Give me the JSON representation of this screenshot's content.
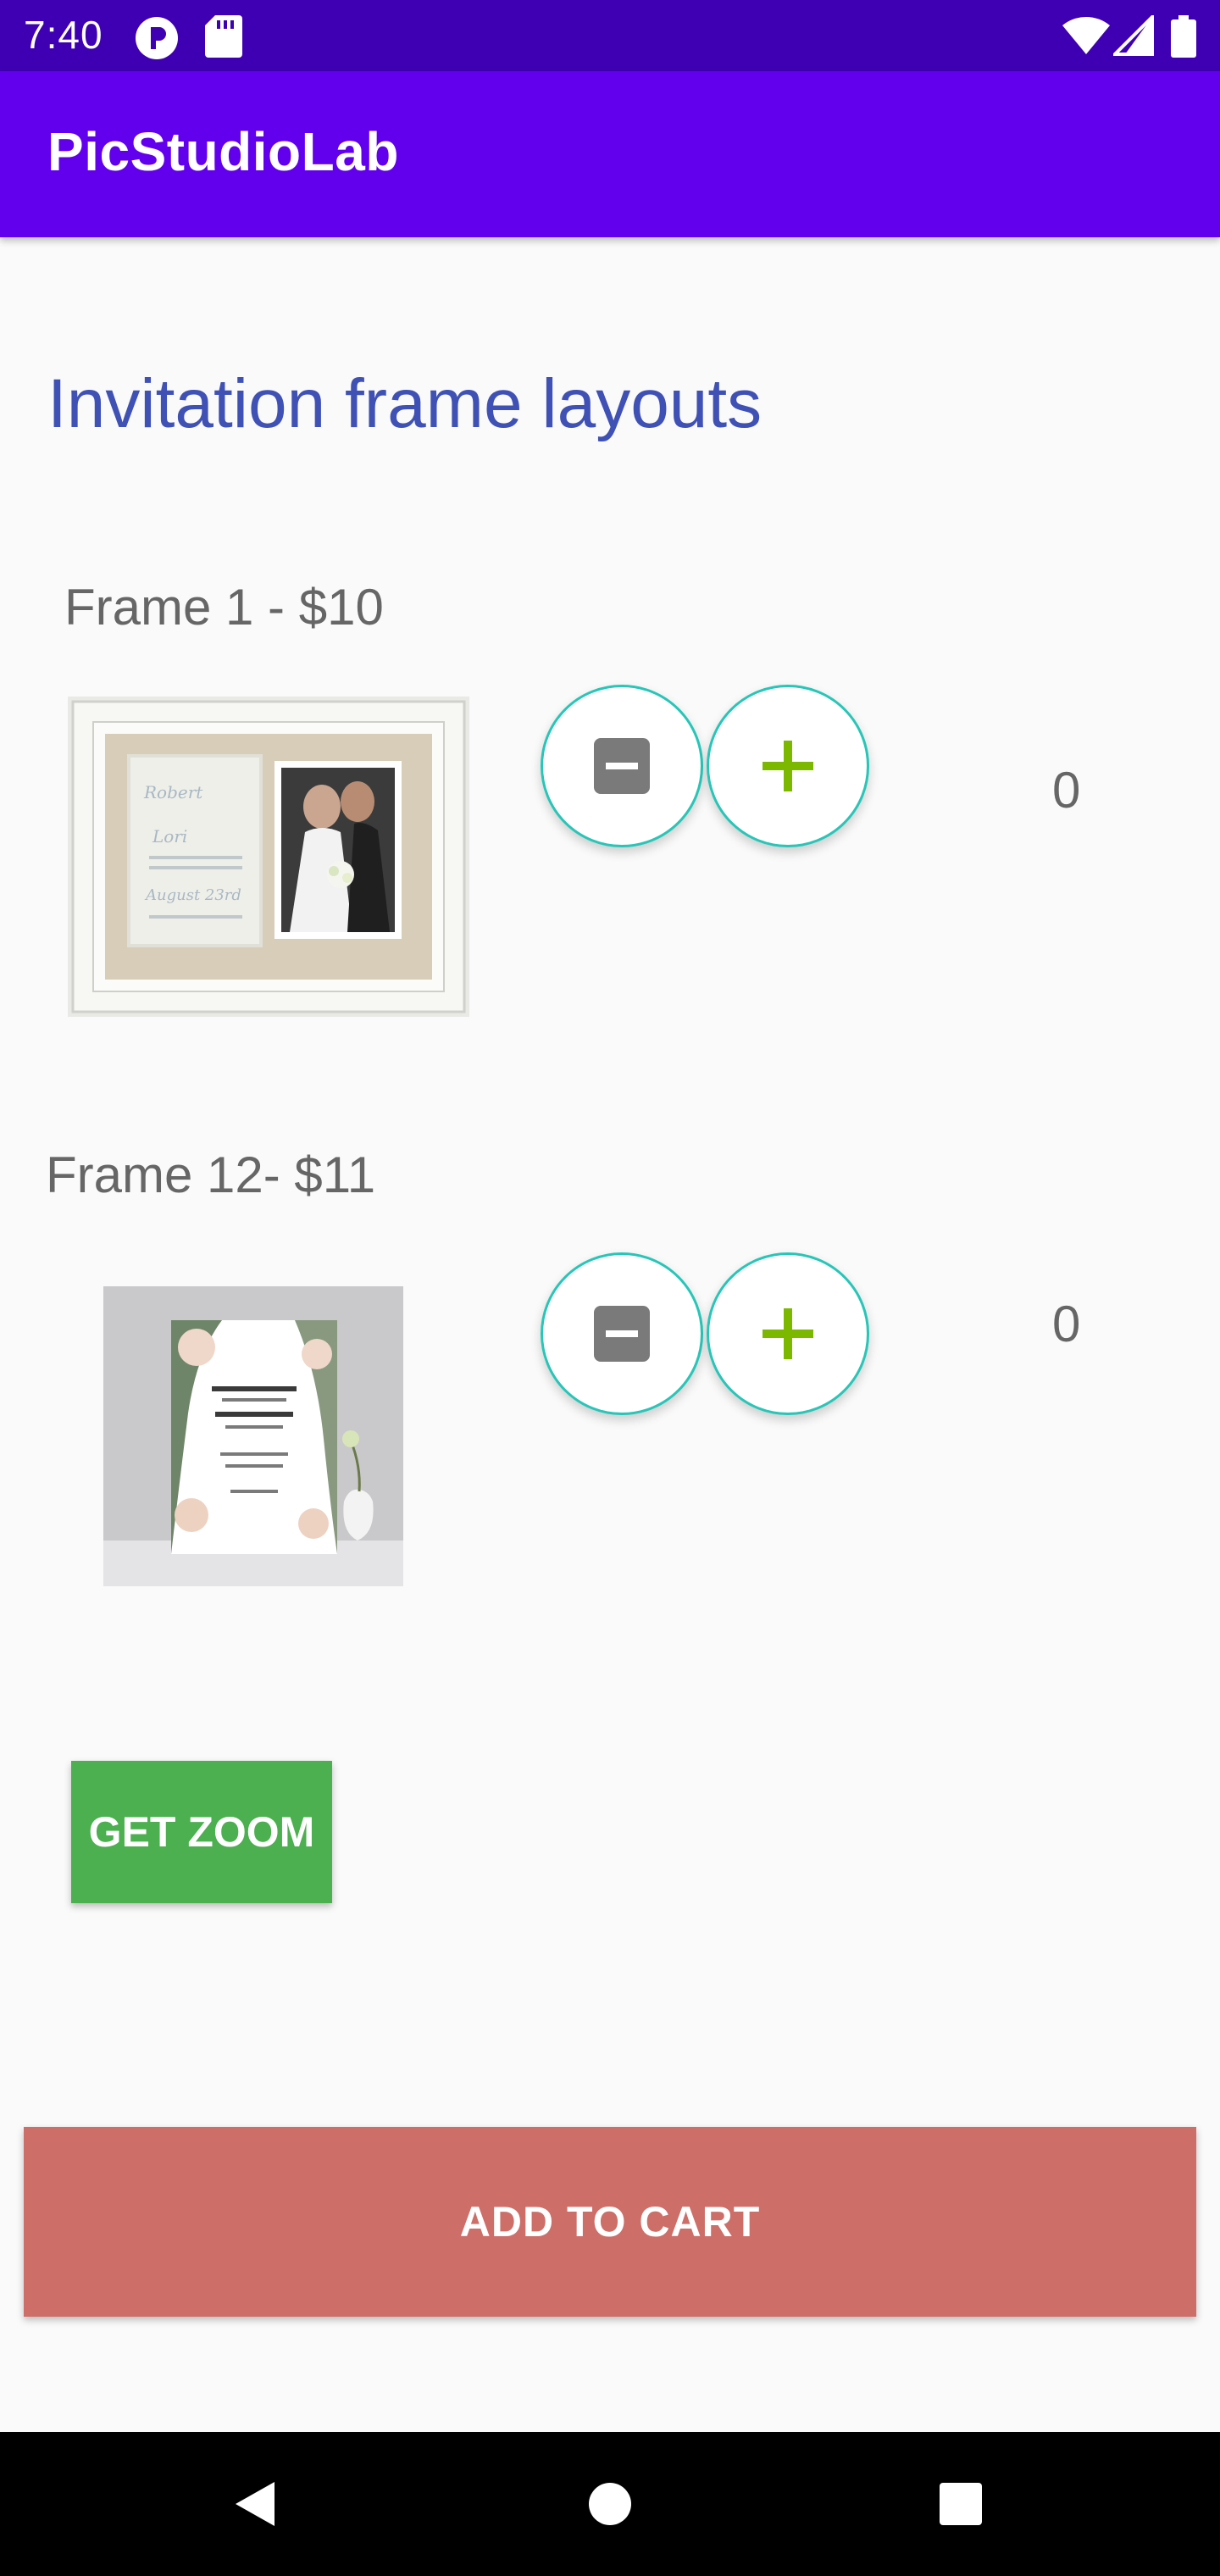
{
  "status_bar": {
    "time": "7:40",
    "icons": [
      "p-icon",
      "sd-card-icon",
      "wifi-icon",
      "signal-icon",
      "battery-icon"
    ]
  },
  "app_bar": {
    "title": "PicStudioLab"
  },
  "main": {
    "heading": "Invitation frame layouts",
    "frames": [
      {
        "label": "Frame 1 - $10",
        "quantity": "0"
      },
      {
        "label": "Frame 12- $11",
        "quantity": "0"
      }
    ],
    "zoom_button": "GET ZOOM",
    "cart_button": "ADD TO CART"
  },
  "nav_bar": {
    "icons": [
      "back-icon",
      "home-icon",
      "recents-icon"
    ]
  },
  "colors": {
    "status_bar": "#3F00B3",
    "app_bar": "#6200EE",
    "heading": "#3F51B5",
    "zoom_button": "#4CAF50",
    "cart_button": "#CD6E69",
    "button_border": "#26C6B8",
    "plus": "#7CB800"
  }
}
